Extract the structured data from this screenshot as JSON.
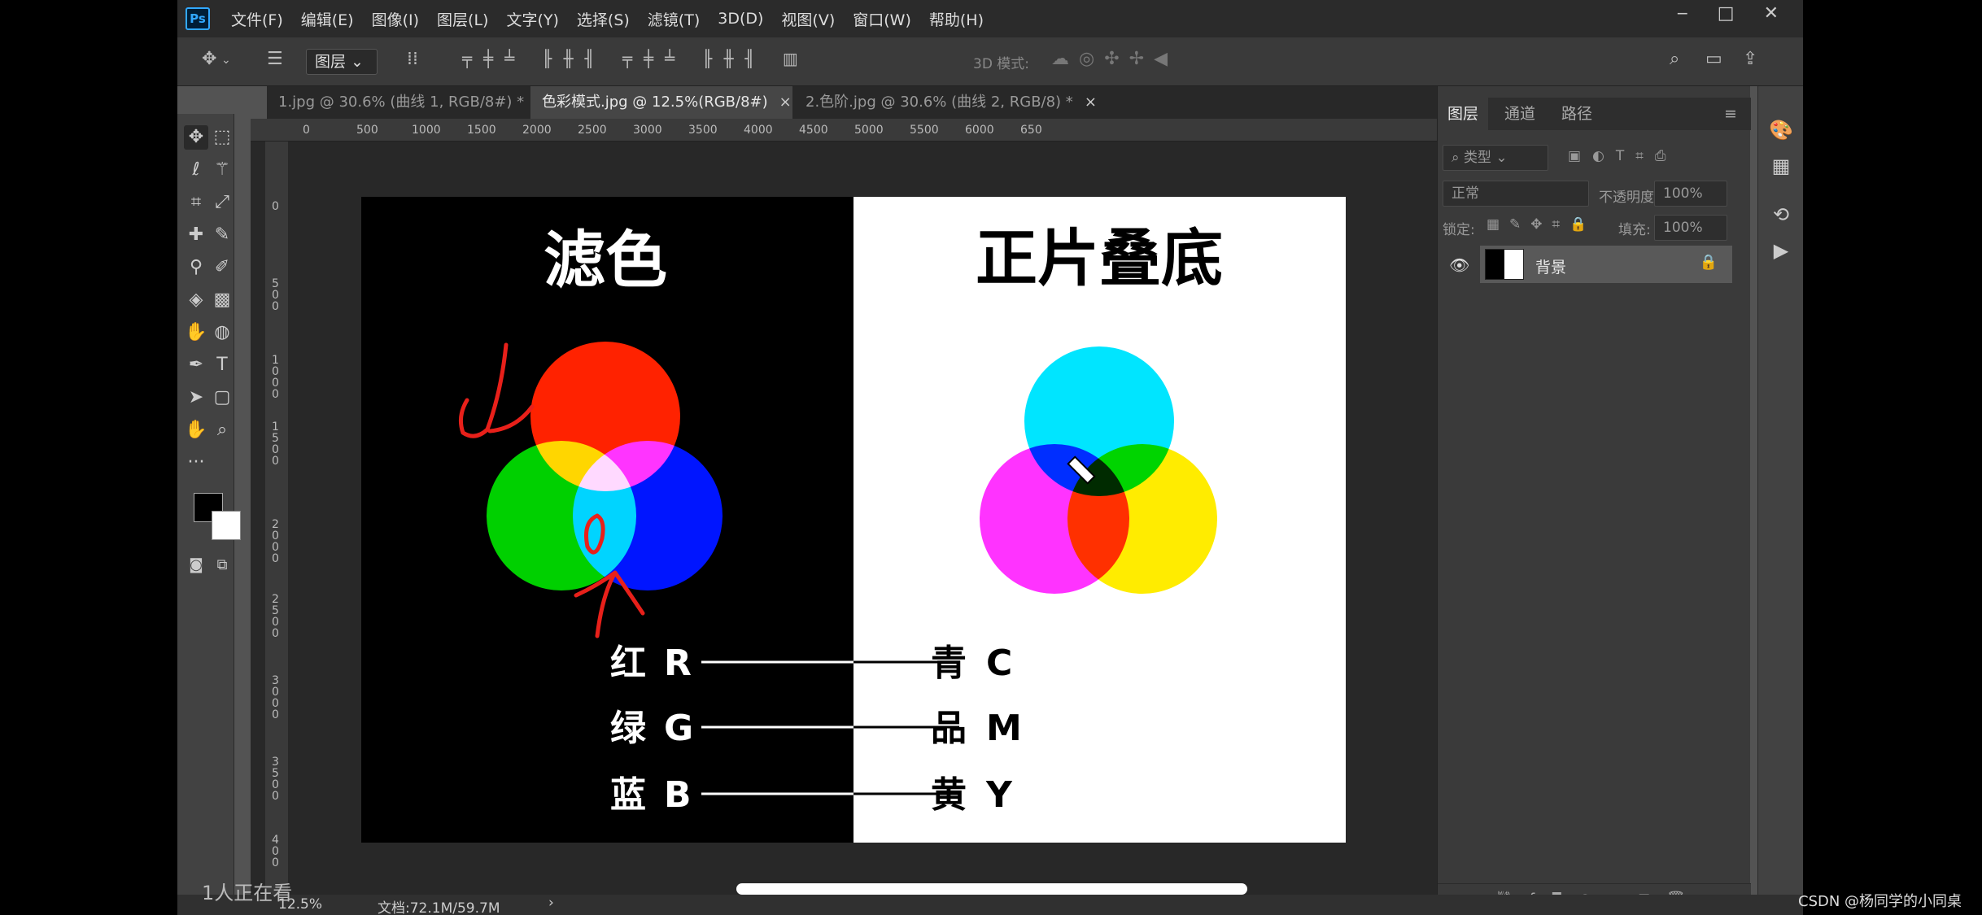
{
  "menubar": {
    "logo": "Ps",
    "items": [
      "文件(F)",
      "编辑(E)",
      "图像(I)",
      "图层(L)",
      "文字(Y)",
      "选择(S)",
      "滤镜(T)",
      "3D(D)",
      "视图(V)",
      "窗口(W)",
      "帮助(H)"
    ]
  },
  "options": {
    "layer_select": "图层",
    "mode_3d": "3D 模式:"
  },
  "tabs": [
    {
      "label": "1.jpg @ 30.6% (曲线 1, RGB/8#) *",
      "close": "×"
    },
    {
      "label": "色彩模式.jpg @ 12.5%(RGB/8#)",
      "close": "×"
    },
    {
      "label": "2.色阶.jpg @ 30.6% (曲线 2, RGB/8) *",
      "close": "×"
    }
  ],
  "ruler": {
    "top": [
      "0",
      "500",
      "1000",
      "1500",
      "2000",
      "2500",
      "3000",
      "3500",
      "4000",
      "4500",
      "5000",
      "5500",
      "6000",
      "650"
    ],
    "left": [
      "0",
      "5\n0\n0",
      "1\n0\n0\n0",
      "1\n5\n0\n0",
      "2\n0\n0\n0",
      "2\n5\n0\n0",
      "3\n0\n0\n0",
      "3\n5\n0\n0",
      "4\n0\n0"
    ]
  },
  "doc": {
    "left_title": "滤色",
    "right_title": "正片叠底",
    "left_rows": [
      {
        "cn": "红",
        "en": "R"
      },
      {
        "cn": "绿",
        "en": "G"
      },
      {
        "cn": "蓝",
        "en": "B"
      }
    ],
    "right_rows": [
      {
        "cn": "青",
        "en": "C"
      },
      {
        "cn": "品",
        "en": "M"
      },
      {
        "cn": "黄",
        "en": "Y"
      }
    ],
    "colors": {
      "red": "#ff2200",
      "green": "#00d000",
      "blue": "#0015ff",
      "cyan": "#00e5ff",
      "magenta": "#ff33ff",
      "yellow": "#ffec00",
      "annotation": "#e8201a"
    }
  },
  "status": {
    "zoom": "12.5%",
    "doc_size": "文档:72.1M/59.7M",
    "arrow": "›"
  },
  "layers_panel": {
    "tabs": [
      "图层",
      "通道",
      "路径"
    ],
    "filter_kind": "类型",
    "blend_mode": "正常",
    "opacity_label": "不透明度:",
    "opacity_value": "100%",
    "lock_label": "锁定:",
    "fill_label": "填充:",
    "fill_value": "100%",
    "layer_name": "背景"
  },
  "overlay": {
    "viewers": "1人正在看",
    "watermark": "CSDN @杨同学的小同桌"
  },
  "icons": [
    "move-icon",
    "marquee-icon",
    "lasso-icon",
    "magic-wand-icon",
    "crop-icon",
    "eyedropper-icon",
    "healing-icon",
    "brush-icon",
    "stamp-icon",
    "history-brush-icon",
    "eraser-icon",
    "gradient-icon",
    "blur-icon",
    "dodge-icon",
    "pen-icon",
    "type-icon",
    "path-select-icon",
    "shape-icon",
    "hand-icon",
    "zoom-icon",
    "more-icon",
    "search-icon",
    "eye-icon",
    "lock-icon"
  ]
}
